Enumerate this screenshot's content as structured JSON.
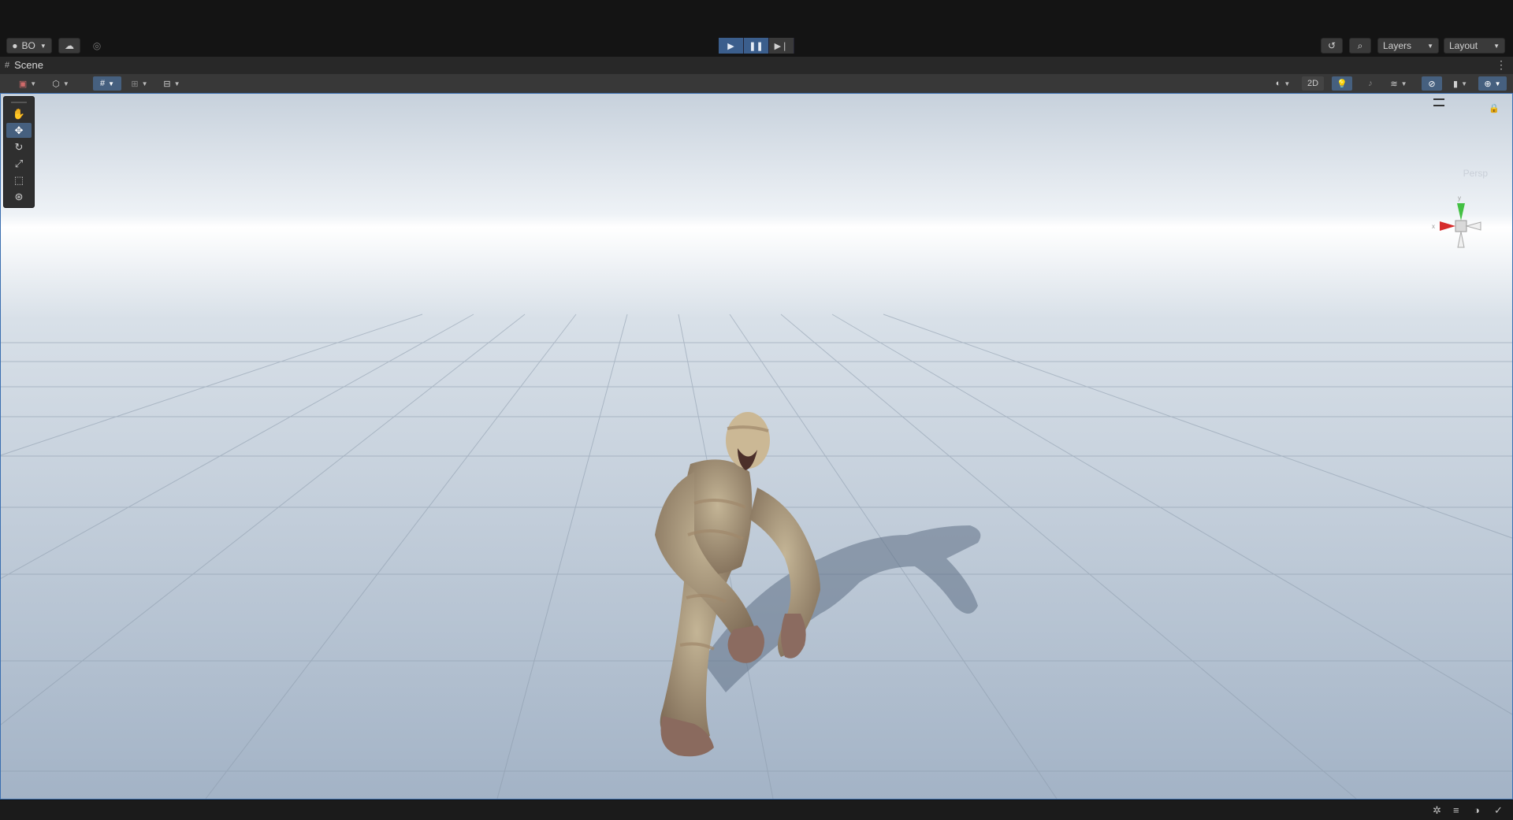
{
  "topbar": {
    "account_label": "BO",
    "layers_label": "Layers",
    "layout_label": "Layout",
    "icons": {
      "account": "account-icon",
      "cloud": "cloud-icon",
      "collab": "collab-icon",
      "play": "play-icon",
      "pause": "pause-icon",
      "step": "step-icon",
      "history": "history-icon",
      "search": "search-icon"
    }
  },
  "scene_tab": {
    "title": "Scene",
    "icon": "grid-icon"
  },
  "scene_toolbar": {
    "twod_label": "2D",
    "icons": [
      "draw-mode-icon",
      "render-mode-icon",
      "snap-icon",
      "grid-snap-icon",
      "increment-icon",
      "shading-icon",
      "lighting-icon",
      "audio-icon",
      "effects-icon",
      "hidden-objects-icon",
      "camera-icon",
      "gizmos-icon"
    ]
  },
  "tools": [
    "hand-icon",
    "move-icon",
    "rotate-icon",
    "scale-icon",
    "rect-icon",
    "transform-icon"
  ],
  "gizmo": {
    "projection_label": "Persp",
    "icon": "scene-gizmo-icon"
  },
  "colors": {
    "accent": "#46607f",
    "play_bg": "#3b5e8c",
    "sky_top": "#c7d1dc",
    "horizon": "#ffffff",
    "ground": "#a7b6c7",
    "viewport_border": "#3b6fb0"
  },
  "statusbar": {
    "icons": [
      "bug-icon",
      "cache-icon",
      "lighting-status-icon",
      "check-icon"
    ]
  }
}
